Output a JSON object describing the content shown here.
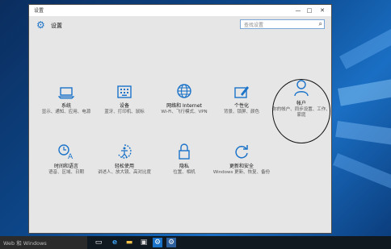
{
  "window": {
    "title": "设置",
    "minimize": "—",
    "maximize": "□",
    "close": "✕"
  },
  "header": {
    "title": "设置",
    "search_placeholder": "查找设置"
  },
  "tiles": [
    {
      "name": "系统",
      "desc": "显示、通知、应用、电源",
      "icon": "laptop-icon"
    },
    {
      "name": "设备",
      "desc": "蓝牙、打印机、鼠标",
      "icon": "keyboard-icon"
    },
    {
      "name": "网络和 Internet",
      "desc": "Wi-Fi、飞行模式、VPN",
      "icon": "globe-icon"
    },
    {
      "name": "个性化",
      "desc": "背景、锁屏、颜色",
      "icon": "pen-icon"
    },
    {
      "name": "帐户",
      "desc": "你的帐户、同步设置、工作、家庭",
      "icon": "person-icon"
    },
    {
      "name": "时间和语言",
      "desc": "语音、区域、日期",
      "icon": "clock-language-icon"
    },
    {
      "name": "轻松使用",
      "desc": "讲述人、放大镜、高对比度",
      "icon": "ease-of-access-icon"
    },
    {
      "name": "隐私",
      "desc": "位置、相机",
      "icon": "lock-icon"
    },
    {
      "name": "更新和安全",
      "desc": "Windows 更新、恢复、备份",
      "icon": "update-icon"
    }
  ],
  "taskbar": {
    "search_text": "Web 和 Windows",
    "icons": [
      "task-view-icon",
      "edge-icon",
      "explorer-icon",
      "store-icon",
      "settings-icon"
    ]
  },
  "colors": {
    "accent": "#1a73c9",
    "window_bg": "#e6e6e6",
    "taskbar": "#101820"
  }
}
